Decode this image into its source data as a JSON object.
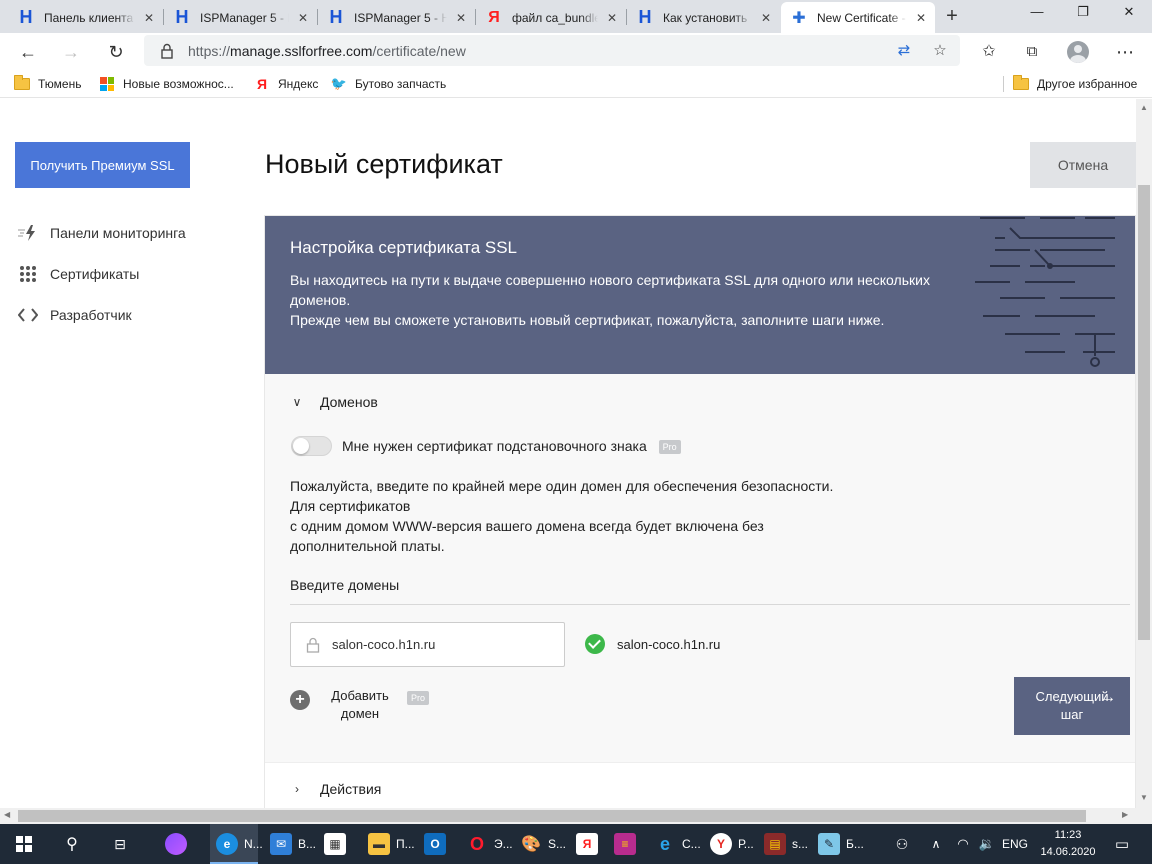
{
  "browser": {
    "tabs": [
      {
        "title": "Панель клиента",
        "icon": "h-logo-icon"
      },
      {
        "title": "ISPManager 5 - Н",
        "icon": "h-logo-icon"
      },
      {
        "title": "ISPManager 5 - Н",
        "icon": "h-logo-icon"
      },
      {
        "title": "файл ca_bundle",
        "icon": "yandex-icon"
      },
      {
        "title": "Как установить",
        "icon": "h-logo-icon"
      },
      {
        "title": "New Certificate -",
        "icon": "puzzle-icon",
        "active": true
      }
    ],
    "url_prefix": "https://",
    "url_host": "manage.sslforfree.com",
    "url_path": "/certificate/new"
  },
  "bookmarks": {
    "items": [
      {
        "label": "Тюмень",
        "icon": "folder-icon"
      },
      {
        "label": "Новые возможнос...",
        "icon": "microsoft-icon"
      },
      {
        "label": "Яндекс",
        "icon": "yandex-icon"
      },
      {
        "label": "Бутово запчасть",
        "icon": "bird-icon"
      }
    ],
    "other": "Другое избранное"
  },
  "sidebar": {
    "premium_button": "Получить Премиум SSL",
    "items": [
      {
        "label": "Панели мониторинга",
        "icon": "bolt-icon"
      },
      {
        "label": "Сертификаты",
        "icon": "grid-icon"
      },
      {
        "label": "Разработчик",
        "icon": "code-icon"
      }
    ]
  },
  "main": {
    "title": "Новый сертификат",
    "cancel": "Отмена",
    "card": {
      "heading": "Настройка сертификата SSL",
      "desc1": "Вы находитесь на пути к выдаче совершенно нового сертификата SSL для одного или нескольких доменов.",
      "desc2": "Прежде чем вы сможете установить новый сертификат, пожалуйста, заполните шаги ниже."
    },
    "domains_section": {
      "title": "Доменов",
      "wildcard_label": "Мне нужен сертификат подстановочного знака",
      "pro_badge": "Pro",
      "wildcard_enabled": false,
      "info_line1": "Пожалуйста, введите по крайней мере один домен для обеспечения безопасности.",
      "info_line2": "Для сертификатов",
      "info_line3": "с одним домом WWW-версия вашего домена всегда будет включена без дополнительной платы.",
      "enter_label": "Введите домены",
      "domain_value": "salon-coco.h1n.ru",
      "verified_domain": "salon-coco.h1n.ru",
      "add_domain_line1": "Добавить",
      "add_domain_line2": "домен",
      "next_line1": "Следующий",
      "next_line2": "шаг"
    },
    "actions_section": {
      "title": "Действия"
    }
  },
  "taskbar": {
    "apps": [
      {
        "label": "N...",
        "icon": "edge-icon",
        "active": true
      },
      {
        "label": "В...",
        "icon": "mail-icon"
      },
      {
        "label": "",
        "icon": "store-icon"
      },
      {
        "label": "П...",
        "icon": "explorer-icon"
      },
      {
        "label": "",
        "icon": "outlook-icon"
      },
      {
        "label": "Э...",
        "icon": "opera-icon"
      },
      {
        "label": "S...",
        "icon": "paint-icon"
      },
      {
        "label": "",
        "icon": "yandex-icon"
      },
      {
        "label": "",
        "icon": "winrar-icon"
      },
      {
        "label": "С...",
        "icon": "ie-icon"
      },
      {
        "label": "Р...",
        "icon": "yandex-browser-icon"
      },
      {
        "label": "s...",
        "icon": "archive-icon"
      },
      {
        "label": "Б...",
        "icon": "notepad-icon"
      }
    ],
    "lang": "ENG",
    "time": "11:23",
    "date": "14.06.2020"
  }
}
